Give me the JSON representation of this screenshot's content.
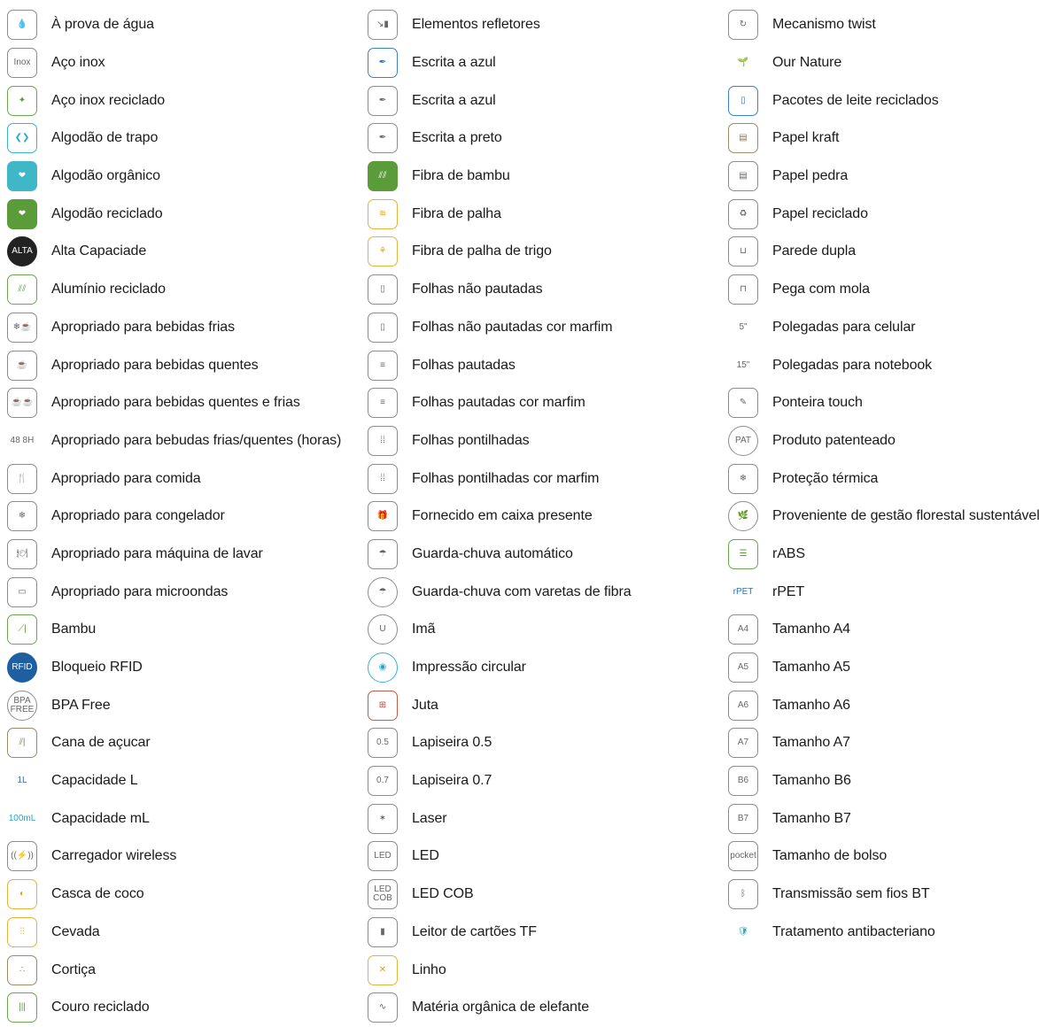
{
  "columns": [
    [
      {
        "label": "À prova de água",
        "icon": "water-drop-icon",
        "glyph": "💧",
        "cls": ""
      },
      {
        "label": "Aço inox",
        "icon": "inox-icon",
        "glyph": "Inox",
        "cls": ""
      },
      {
        "label": "Aço inox reciclado",
        "icon": "recycled-steel-icon",
        "glyph": "✦",
        "cls": "g"
      },
      {
        "label": "Algodão de trapo",
        "icon": "rag-cotton-icon",
        "glyph": "❮❯",
        "cls": "t"
      },
      {
        "label": "Algodão orgânico",
        "icon": "organic-cotton-icon",
        "glyph": "❤",
        "cls": "fillt"
      },
      {
        "label": "Algodão reciclado",
        "icon": "recycled-cotton-icon",
        "glyph": "❤",
        "cls": "fillg"
      },
      {
        "label": "Alta Capaciade",
        "icon": "high-capacity-icon",
        "glyph": "ALTA",
        "cls": "fillk round"
      },
      {
        "label": "Alumínio reciclado",
        "icon": "recycled-aluminium-icon",
        "glyph": "⫽⫽",
        "cls": "g"
      },
      {
        "label": "Apropriado para bebidas frias",
        "icon": "cold-drink-icon",
        "glyph": "❄☕",
        "cls": ""
      },
      {
        "label": "Apropriado para bebidas quentes",
        "icon": "hot-drink-icon",
        "glyph": "☕",
        "cls": ""
      },
      {
        "label": "Apropriado para bebidas quentes e frias",
        "icon": "hot-cold-drink-icon",
        "glyph": "☕☕",
        "cls": ""
      },
      {
        "label": "Apropriado para bebudas frias/quentes (horas)",
        "icon": "hours-hot-cold-icon",
        "glyph": "48 8H",
        "cls": "nob"
      },
      {
        "label": "Apropriado para comida",
        "icon": "food-icon",
        "glyph": "🍴",
        "cls": ""
      },
      {
        "label": "Apropriado para congelador",
        "icon": "freezer-icon",
        "glyph": "❄",
        "cls": ""
      },
      {
        "label": "Apropriado para máquina de lavar",
        "icon": "dishwasher-icon",
        "glyph": "🍽",
        "cls": ""
      },
      {
        "label": "Apropriado para microondas",
        "icon": "microwave-icon",
        "glyph": "▭",
        "cls": ""
      },
      {
        "label": "Bambu",
        "icon": "bamboo-icon",
        "glyph": "⟋|",
        "cls": "g"
      },
      {
        "label": "Bloqueio RFID",
        "icon": "rfid-block-icon",
        "glyph": "RFID",
        "cls": "fillb round"
      },
      {
        "label": "BPA Free",
        "icon": "bpa-free-icon",
        "glyph": "BPA FREE",
        "cls": "round"
      },
      {
        "label": "Cana de açucar",
        "icon": "sugar-cane-icon",
        "glyph": "⫽|",
        "cls": "br"
      },
      {
        "label": "Capacidade L",
        "icon": "capacity-l-icon",
        "glyph": "1L",
        "cls": "nob b"
      },
      {
        "label": "Capacidade mL",
        "icon": "capacity-ml-icon",
        "glyph": "100mL",
        "cls": "nob t"
      },
      {
        "label": "Carregador wireless",
        "icon": "wireless-charger-icon",
        "glyph": "((⚡))",
        "cls": ""
      },
      {
        "label": "Casca de coco",
        "icon": "coconut-icon",
        "glyph": "◐",
        "cls": "y"
      },
      {
        "label": "Cevada",
        "icon": "barley-icon",
        "glyph": "⫶⫶",
        "cls": "y"
      },
      {
        "label": "Cortiça",
        "icon": "cork-icon",
        "glyph": "∴",
        "cls": "br"
      },
      {
        "label": "Couro reciclado",
        "icon": "recycled-leather-icon",
        "glyph": "|||",
        "cls": "g"
      }
    ],
    [
      {
        "label": "Elementos refletores",
        "icon": "reflective-icon",
        "glyph": "↘▮",
        "cls": ""
      },
      {
        "label": "Escrita a azul",
        "icon": "pen-blue-icon",
        "glyph": "✒",
        "cls": "b"
      },
      {
        "label": "Escrita a azul",
        "icon": "pen-blue-2-icon",
        "glyph": "✒",
        "cls": ""
      },
      {
        "label": "Escrita a preto",
        "icon": "pen-black-icon",
        "glyph": "✒",
        "cls": ""
      },
      {
        "label": "Fibra de bambu",
        "icon": "bamboo-fiber-icon",
        "glyph": "⫽⫽",
        "cls": "fillg"
      },
      {
        "label": "Fibra de palha",
        "icon": "straw-fiber-icon",
        "glyph": "≋",
        "cls": "y"
      },
      {
        "label": "Fibra de palha de trigo",
        "icon": "wheat-straw-icon",
        "glyph": "⚘",
        "cls": "y"
      },
      {
        "label": "Folhas não pautadas",
        "icon": "blank-sheet-icon",
        "glyph": "▯",
        "cls": ""
      },
      {
        "label": "Folhas não pautadas cor marfim",
        "icon": "blank-ivory-sheet-icon",
        "glyph": "▯",
        "cls": ""
      },
      {
        "label": "Folhas pautadas",
        "icon": "lined-sheet-icon",
        "glyph": "≡",
        "cls": ""
      },
      {
        "label": "Folhas pautadas cor marfim",
        "icon": "lined-ivory-sheet-icon",
        "glyph": "≡",
        "cls": ""
      },
      {
        "label": "Folhas pontilhadas",
        "icon": "dotted-sheet-icon",
        "glyph": "⁞⁞",
        "cls": ""
      },
      {
        "label": "Folhas pontilhadas cor marfim",
        "icon": "dotted-ivory-sheet-icon",
        "glyph": "⁞⁞",
        "cls": ""
      },
      {
        "label": "Fornecido em caixa presente",
        "icon": "gift-box-icon",
        "glyph": "🎁",
        "cls": ""
      },
      {
        "label": "Guarda-chuva automático",
        "icon": "auto-umbrella-icon",
        "glyph": "☂",
        "cls": ""
      },
      {
        "label": "Guarda-chuva com varetas de fibra",
        "icon": "fiber-umbrella-icon",
        "glyph": "☂",
        "cls": "round"
      },
      {
        "label": "Imã",
        "icon": "magnet-icon",
        "glyph": "U",
        "cls": "round"
      },
      {
        "label": "Impressão circular",
        "icon": "circular-print-icon",
        "glyph": "◉",
        "cls": "round t"
      },
      {
        "label": "Juta",
        "icon": "jute-icon",
        "glyph": "⊞",
        "cls": "r"
      },
      {
        "label": "Lapiseira 0.5",
        "icon": "pencil-05-icon",
        "glyph": "0.5",
        "cls": ""
      },
      {
        "label": "Lapiseira 0.7",
        "icon": "pencil-07-icon",
        "glyph": "0.7",
        "cls": ""
      },
      {
        "label": "Laser",
        "icon": "laser-icon",
        "glyph": "✶",
        "cls": ""
      },
      {
        "label": "LED",
        "icon": "led-icon",
        "glyph": "LED",
        "cls": ""
      },
      {
        "label": "LED COB",
        "icon": "led-cob-icon",
        "glyph": "LED COB",
        "cls": ""
      },
      {
        "label": "Leitor de cartões TF",
        "icon": "tf-card-icon",
        "glyph": "▮",
        "cls": ""
      },
      {
        "label": "Linho",
        "icon": "linen-icon",
        "glyph": "✕",
        "cls": "y"
      },
      {
        "label": "Matéria orgânica de elefante",
        "icon": "elephant-icon",
        "glyph": "∿",
        "cls": ""
      }
    ],
    [
      {
        "label": "Mecanismo twist",
        "icon": "twist-icon",
        "glyph": "↻",
        "cls": ""
      },
      {
        "label": "Our Nature",
        "icon": "our-nature-icon",
        "glyph": "🌱",
        "cls": "nob g"
      },
      {
        "label": "Pacotes de leite reciclados",
        "icon": "milk-carton-icon",
        "glyph": "▯",
        "cls": "b"
      },
      {
        "label": "Papel kraft",
        "icon": "kraft-paper-icon",
        "glyph": "▤",
        "cls": "br"
      },
      {
        "label": "Papel pedra",
        "icon": "stone-paper-icon",
        "glyph": "▤",
        "cls": ""
      },
      {
        "label": "Papel reciclado",
        "icon": "recycled-paper-icon",
        "glyph": "♻",
        "cls": ""
      },
      {
        "label": "Parede dupla",
        "icon": "double-wall-icon",
        "glyph": "⊔",
        "cls": ""
      },
      {
        "label": "Pega com mola",
        "icon": "spring-handle-icon",
        "glyph": "⊓",
        "cls": ""
      },
      {
        "label": "Polegadas para celular",
        "icon": "phone-inch-icon",
        "glyph": "5\"",
        "cls": "nob"
      },
      {
        "label": "Polegadas para notebook",
        "icon": "notebook-inch-icon",
        "glyph": "15\"",
        "cls": "nob"
      },
      {
        "label": "Ponteira touch",
        "icon": "touch-stylus-icon",
        "glyph": "✎",
        "cls": ""
      },
      {
        "label": "Produto patenteado",
        "icon": "patent-icon",
        "glyph": "PAT",
        "cls": "round"
      },
      {
        "label": "Proteção térmica",
        "icon": "thermal-protection-icon",
        "glyph": "❄",
        "cls": ""
      },
      {
        "label": "Proveniente de gestão florestal sustentável",
        "icon": "forest-icon",
        "glyph": "🌿",
        "cls": "round"
      },
      {
        "label": "rABS",
        "icon": "rabs-icon",
        "glyph": "☰",
        "cls": "g"
      },
      {
        "label": "rPET",
        "icon": "rpet-icon",
        "glyph": "rPET",
        "cls": "nob b"
      },
      {
        "label": "Tamanho A4",
        "icon": "size-a4-icon",
        "glyph": "A4",
        "cls": ""
      },
      {
        "label": "Tamanho A5",
        "icon": "size-a5-icon",
        "glyph": "A5",
        "cls": ""
      },
      {
        "label": "Tamanho A6",
        "icon": "size-a6-icon",
        "glyph": "A6",
        "cls": ""
      },
      {
        "label": "Tamanho A7",
        "icon": "size-a7-icon",
        "glyph": "A7",
        "cls": ""
      },
      {
        "label": "Tamanho B6",
        "icon": "size-b6-icon",
        "glyph": "B6",
        "cls": ""
      },
      {
        "label": "Tamanho B7",
        "icon": "size-b7-icon",
        "glyph": "B7",
        "cls": ""
      },
      {
        "label": "Tamanho de bolso",
        "icon": "pocket-size-icon",
        "glyph": "pocket",
        "cls": ""
      },
      {
        "label": "Transmissão sem fios BT",
        "icon": "bluetooth-icon",
        "glyph": "ᛒ",
        "cls": ""
      },
      {
        "label": "Tratamento antibacteriano",
        "icon": "antibacterial-icon",
        "glyph": "🛡",
        "cls": "nob t"
      }
    ]
  ]
}
